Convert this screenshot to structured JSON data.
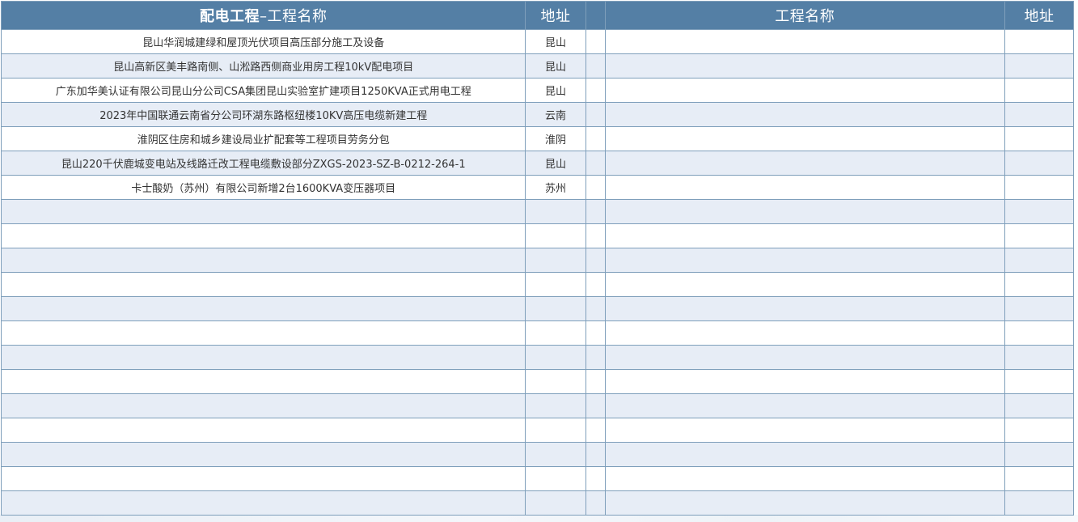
{
  "header": {
    "left_name_bold": "配电工程",
    "left_name_rest": "–工程名称",
    "left_address": "地址",
    "right_name": "工程名称",
    "right_address": "地址"
  },
  "rows": [
    {
      "name": "昆山华润城建绿和屋顶光伏项目高压部分施工及设备",
      "address": "昆山"
    },
    {
      "name": "昆山高新区美丰路南侧、山淞路西侧商业用房工程10kV配电项目",
      "address": "昆山"
    },
    {
      "name": "广东加华美认证有限公司昆山分公司CSA集团昆山实验室扩建项目1250KVA正式用电工程",
      "address": "昆山"
    },
    {
      "name": "2023年中国联通云南省分公司环湖东路枢纽楼10KV高压电缆新建工程",
      "address": "云南"
    },
    {
      "name": "淮阴区住房和城乡建设局业扩配套等工程项目劳务分包",
      "address": "淮阴"
    },
    {
      "name": "昆山220千伏鹿城变电站及线路迁改工程电缆敷设部分ZXGS-2023-SZ-B-0212-264-1",
      "address": "昆山"
    },
    {
      "name": "卡士酸奶（苏州）有限公司新增2台1600KVA变压器项目",
      "address": "苏州"
    },
    {
      "name": "",
      "address": ""
    },
    {
      "name": "",
      "address": ""
    },
    {
      "name": "",
      "address": ""
    },
    {
      "name": "",
      "address": ""
    },
    {
      "name": "",
      "address": ""
    },
    {
      "name": "",
      "address": ""
    },
    {
      "name": "",
      "address": ""
    },
    {
      "name": "",
      "address": ""
    },
    {
      "name": "",
      "address": ""
    },
    {
      "name": "",
      "address": ""
    },
    {
      "name": "",
      "address": ""
    },
    {
      "name": "",
      "address": ""
    },
    {
      "name": "",
      "address": ""
    }
  ]
}
